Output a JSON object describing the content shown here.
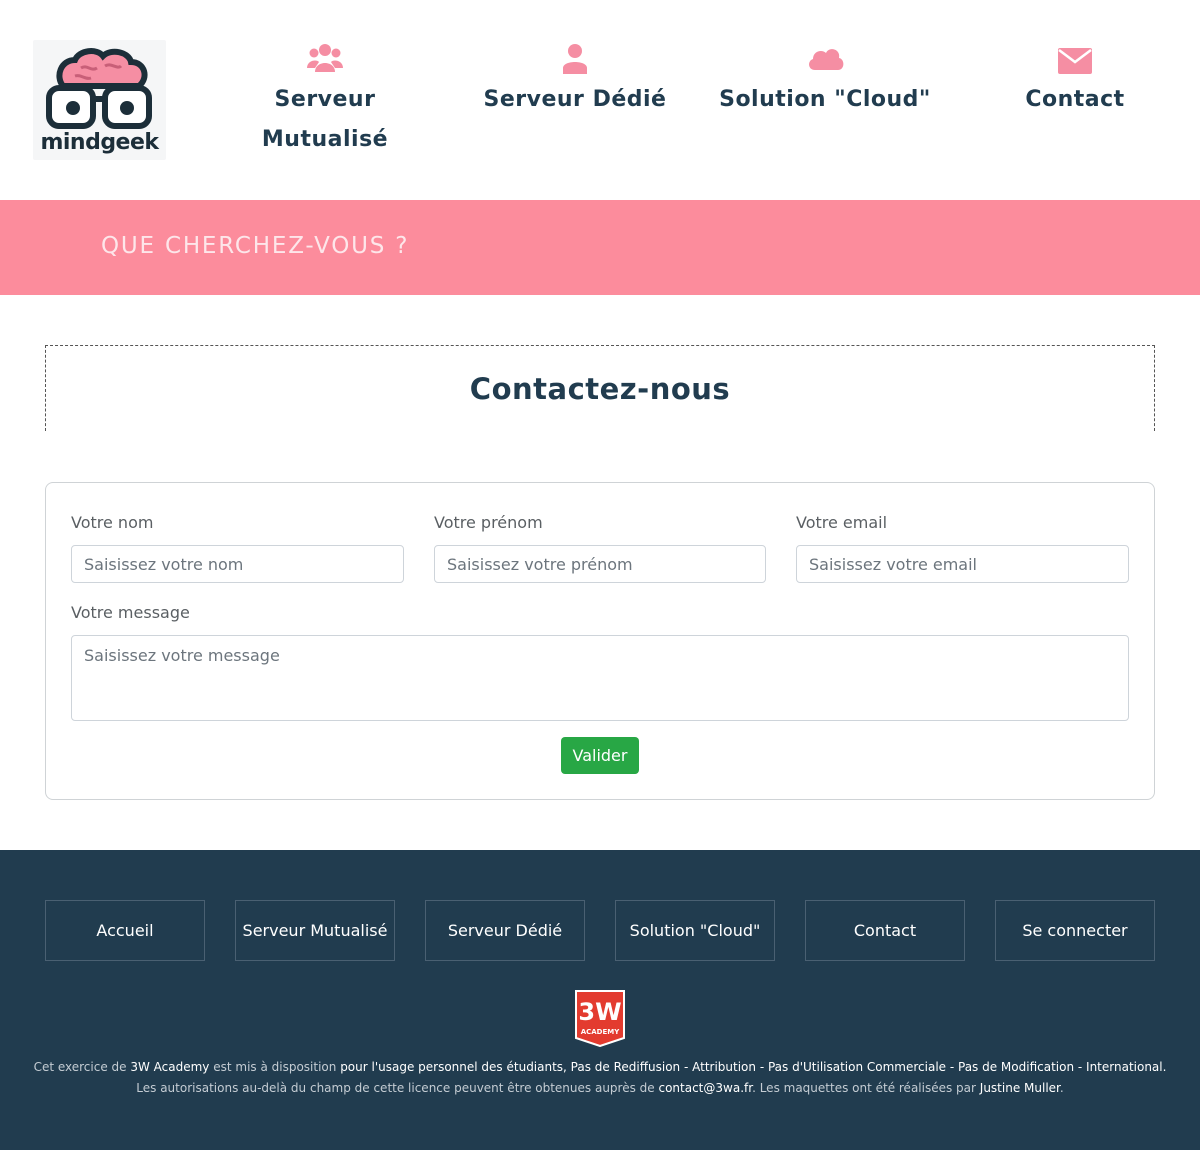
{
  "brand": {
    "name": "mindgeek",
    "colors": {
      "primary": "#213c4f",
      "accent": "#fc8c9c",
      "success": "#28a745"
    }
  },
  "nav": {
    "items": [
      {
        "id": "mutualise",
        "label_line1": "Serveur",
        "label_line2": "Mutualisé",
        "icon": "users-icon"
      },
      {
        "id": "dedie",
        "label": "Serveur Dédié",
        "icon": "user-icon"
      },
      {
        "id": "cloud",
        "label": "Solution \"Cloud\"",
        "icon": "cloud-icon"
      },
      {
        "id": "contact",
        "label": "Contact",
        "icon": "envelope-icon"
      }
    ]
  },
  "banner": {
    "text": "QUE CHERCHEZ-VOUS ?"
  },
  "page": {
    "title": "Contactez-nous"
  },
  "form": {
    "nom": {
      "label": "Votre nom",
      "placeholder": "Saisissez votre nom",
      "value": ""
    },
    "prenom": {
      "label": "Votre prénom",
      "placeholder": "Saisissez votre prénom",
      "value": ""
    },
    "email": {
      "label": "Votre email",
      "placeholder": "Saisissez votre email",
      "value": ""
    },
    "message": {
      "label": "Votre message",
      "placeholder": "Saisissez votre message",
      "value": ""
    },
    "submit_label": "Valider"
  },
  "footer": {
    "links": [
      "Accueil",
      "Serveur Mutualisé",
      "Serveur Dédié",
      "Solution \"Cloud\"",
      "Contact",
      "Se connecter"
    ],
    "academy_logo": {
      "big": "3W",
      "small": "ACADEMY"
    },
    "line1": {
      "p1": "Cet exercice de ",
      "h1": "3W Academy",
      "p2": " est mis à disposition ",
      "h2": "pour l'usage personnel des étudiants, Pas de Rediffusion - Attribution - Pas d'Utilisation Commerciale - Pas de Modification - International."
    },
    "line2": {
      "p1": "Les autorisations au-delà du champ de cette licence peuvent être obtenues auprès de ",
      "h1": "contact@3wa.fr",
      "p2": ". Les maquettes ont été réalisées par ",
      "h2": "Justine Muller",
      "p3": "."
    }
  }
}
